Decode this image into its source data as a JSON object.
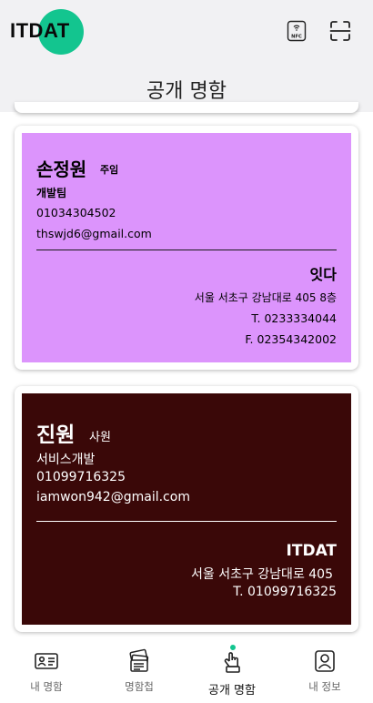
{
  "header": {
    "logo_text": "ITDAT",
    "title": "공개 명함",
    "nfc_label": "NFC",
    "accent_color": "#13c58f"
  },
  "cards": [
    {
      "name": "손정원",
      "position": "주임",
      "department": "개발팀",
      "phone": "01034304502",
      "email": "thswjd6@gmail.com",
      "company": "잇다",
      "address": "서울 서초구 강남대로 405 8층",
      "tel": "T. 0233334044",
      "fax": "F. 02354342002",
      "background_color": "#dc94fc"
    },
    {
      "name": "진원",
      "position": "사원",
      "department": "서비스개발",
      "phone": "01099716325",
      "email": "iamwon942@gmail.com",
      "company": "ITDAT",
      "address": "서울 서초구 강남대로 405",
      "tel": "T. 01099716325",
      "background_color": "#3a0808"
    }
  ],
  "bottom_nav": {
    "items": [
      {
        "label": "내 명함",
        "icon": "id-card-icon"
      },
      {
        "label": "명함첩",
        "icon": "card-stack-icon"
      },
      {
        "label": "공개 명함",
        "icon": "touch-hand-icon",
        "active": true
      },
      {
        "label": "내 정보",
        "icon": "user-profile-icon"
      }
    ]
  }
}
